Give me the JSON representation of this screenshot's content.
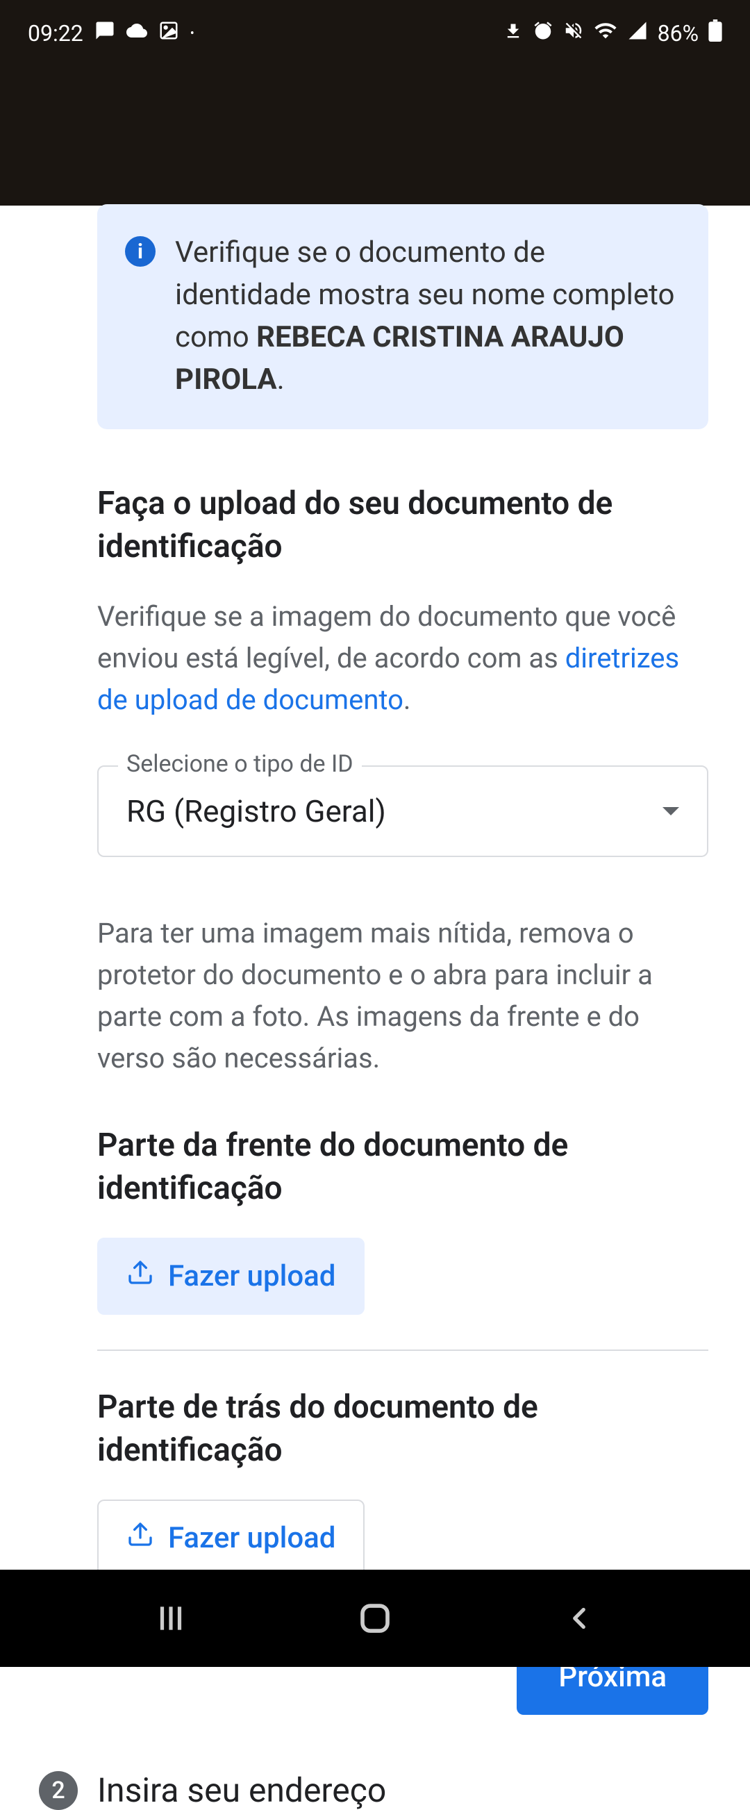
{
  "statusBar": {
    "time": "09:22",
    "battery": "86%"
  },
  "infoBox": {
    "prefix": "Verifique se o documento de identidade mostra seu nome completo como ",
    "name": "REBECA CRISTINA ARAUJO PIROLA",
    "suffix": "."
  },
  "uploadSection": {
    "title": "Faça o upload do seu documento de identificação",
    "descriptionPrefix": "Verifique se a imagem do documento que você enviou está legível, de acordo com as ",
    "linkText": "diretrizes de upload de documento",
    "descriptionSuffix": "."
  },
  "idSelect": {
    "label": "Selecione o tipo de ID",
    "value": "RG (Registro Geral)"
  },
  "imageInstructions": "Para ter uma imagem mais nítida, remova o protetor do documento e o abra para incluir a parte com a foto. As imagens da frente e do verso são necessárias.",
  "frontSection": {
    "title": "Parte da frente do documento de identificação",
    "buttonLabel": "Fazer upload"
  },
  "backSection": {
    "title": "Parte de trás do documento de identificação",
    "buttonLabel": "Fazer upload"
  },
  "nextButton": "Próxima",
  "step2": {
    "number": "2",
    "title": "Insira seu endereço"
  }
}
